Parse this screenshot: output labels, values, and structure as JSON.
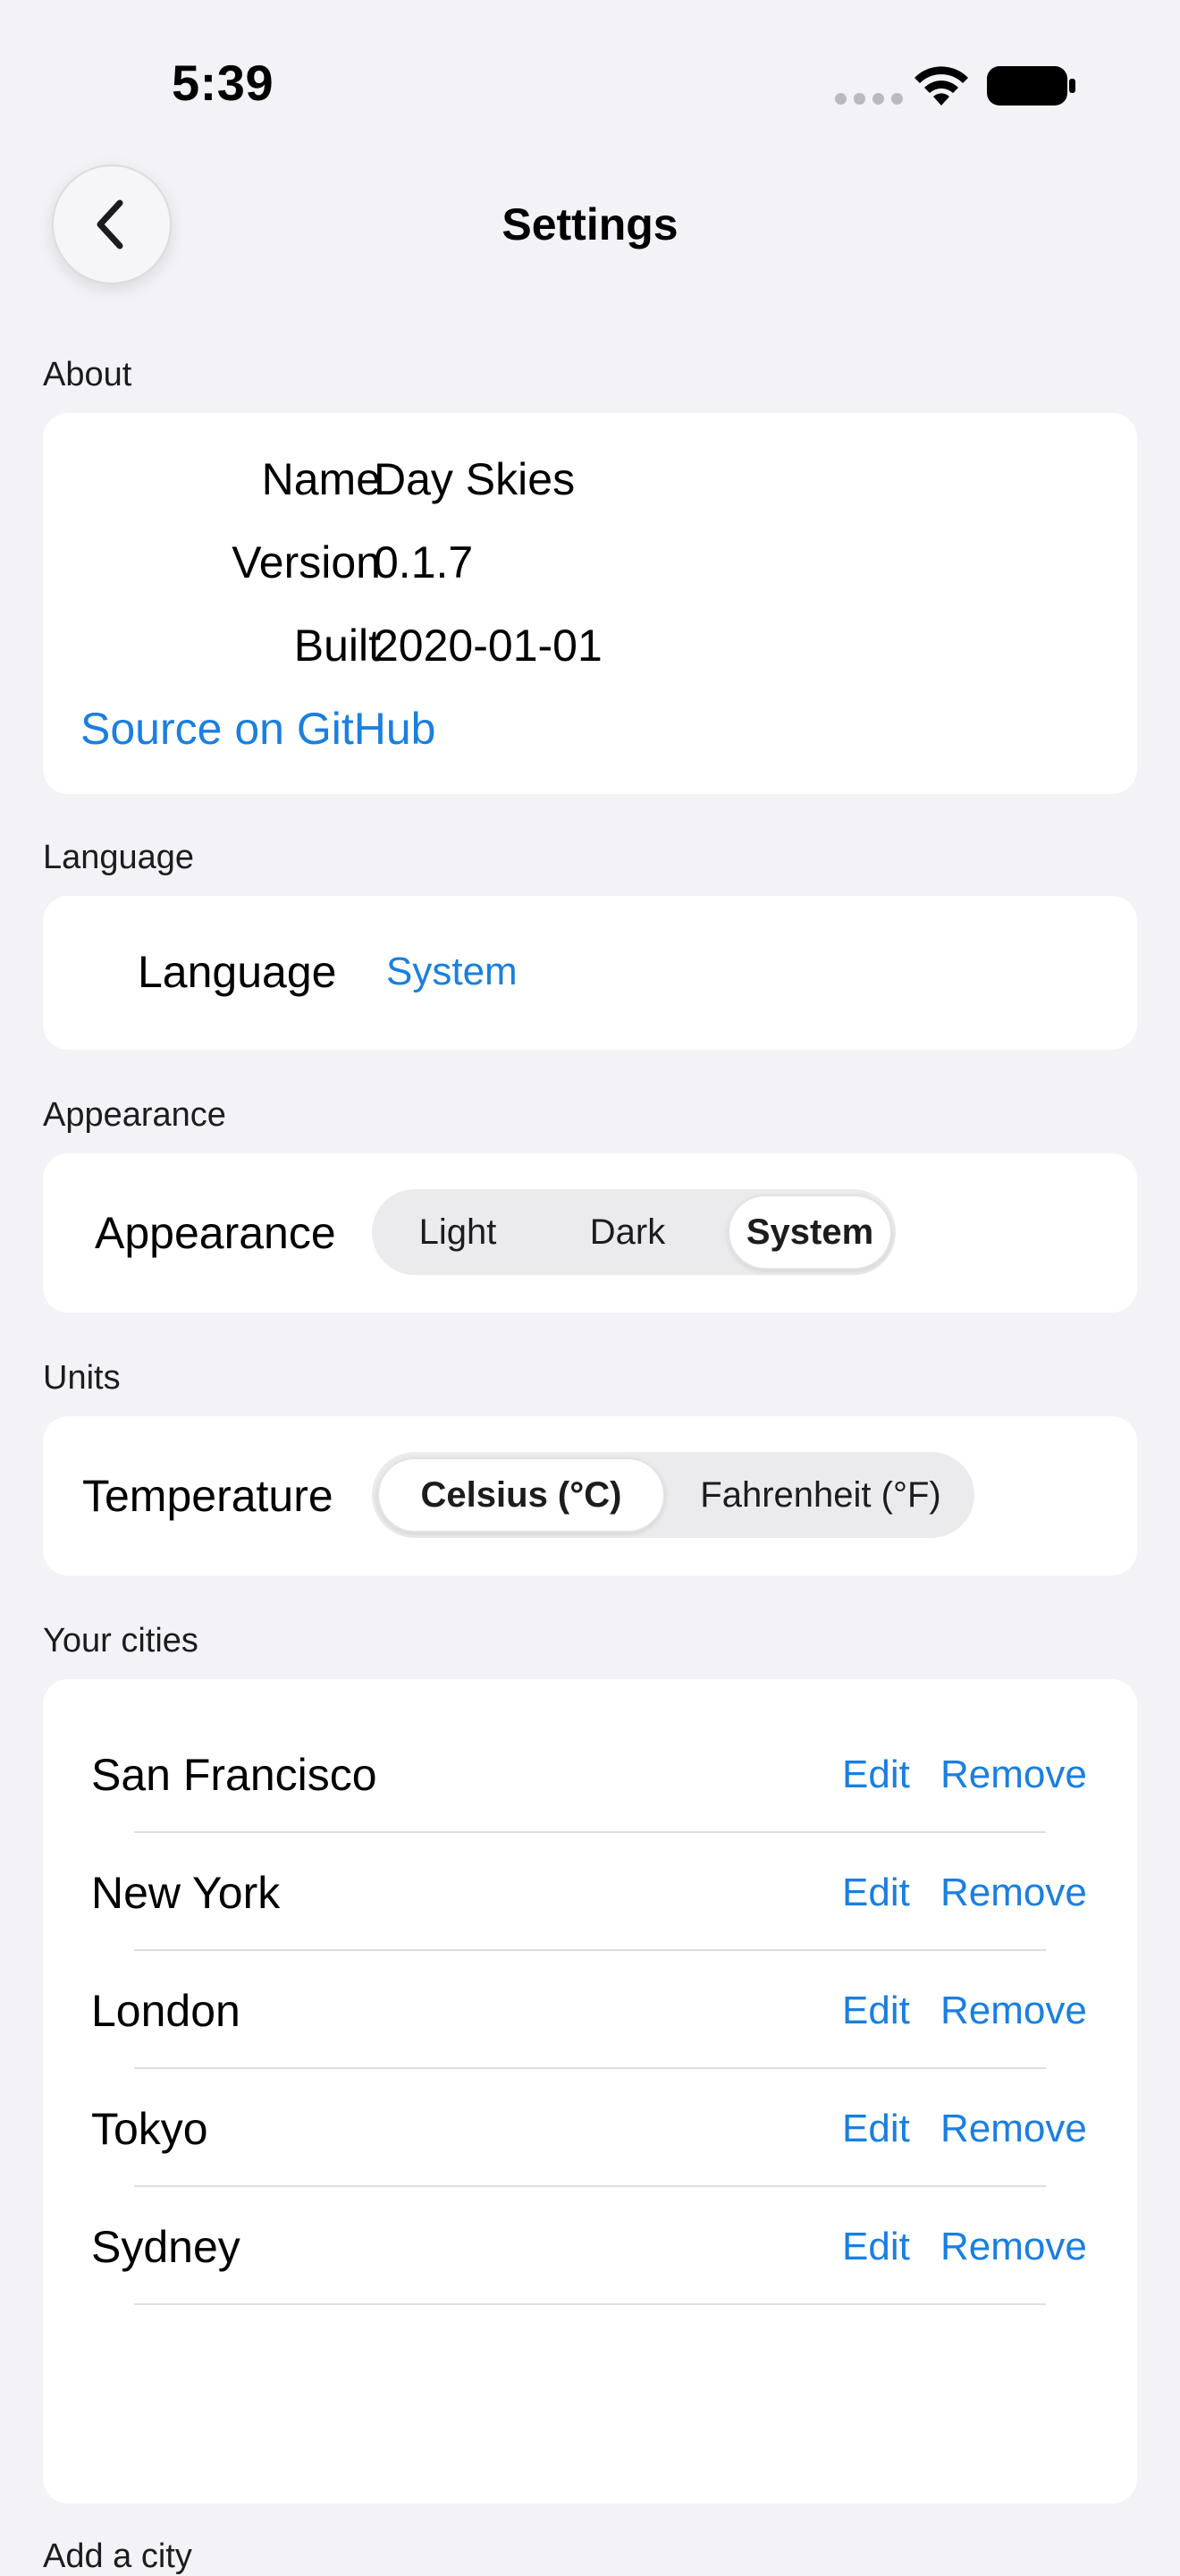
{
  "status_bar": {
    "time": "5:39"
  },
  "nav": {
    "title": "Settings",
    "back_icon": "chevron-left-icon"
  },
  "sections": {
    "about": "About",
    "language": "Language",
    "appearance": "Appearance",
    "units": "Units",
    "cities": "Your cities",
    "add_city": "Add a city"
  },
  "about": {
    "name_label": "Name",
    "name_value": "Day Skies",
    "version_label": "Version",
    "version_value": "0.1.7",
    "built_label": "Built",
    "built_value": "2020-01-01",
    "source_link": "Source on GitHub"
  },
  "language": {
    "label": "Language",
    "value": "System"
  },
  "appearance": {
    "label": "Appearance",
    "options": [
      "Light",
      "Dark",
      "System"
    ],
    "selected": "System"
  },
  "units": {
    "label": "Temperature",
    "options": [
      "Celsius (°C)",
      "Fahrenheit (°F)"
    ],
    "selected": "Celsius (°C)"
  },
  "cities": {
    "edit_label": "Edit",
    "remove_label": "Remove",
    "items": [
      "San Francisco",
      "New York",
      "London",
      "Tokyo",
      "Sydney"
    ]
  },
  "colors": {
    "accent": "#1a7fe0",
    "background": "#f2f2f7",
    "card": "#ffffff"
  }
}
